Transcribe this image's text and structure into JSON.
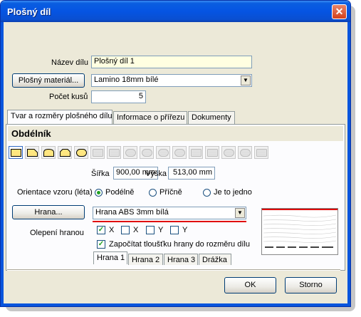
{
  "window": {
    "title": "Plošný díl",
    "close_icon": "close-icon"
  },
  "form": {
    "name_label": "Název dílu",
    "name_value": "Plošný díl 1",
    "material_button": "Plošný materiál...",
    "material_value": "Lamino 18mm bílé",
    "count_label": "Počet kusů",
    "count_value": "5"
  },
  "tabs": [
    {
      "label": "Tvar a rozměry plošného dílu",
      "active": true
    },
    {
      "label": "Informace o přířezu",
      "active": false
    },
    {
      "label": "Dokumenty",
      "active": false
    }
  ],
  "shape": {
    "header": "Obdélník",
    "buttons": [
      "rectangle",
      "chamfer-corner",
      "round-corner",
      "chamfer-both",
      "round-both",
      "hatched-1",
      "hatched-2",
      "oval-1",
      "oval-2",
      "semicircle",
      "circle",
      "hatched-3",
      "hatched-4",
      "oval-3",
      "oval-4",
      "hatched-5"
    ]
  },
  "dimensions": {
    "width_label": "Šířka",
    "width_value": "900,00 mm",
    "height_label": "Výška",
    "height_value": "513,00 mm"
  },
  "orientation": {
    "label": "Orientace vzoru (léta)",
    "options": [
      {
        "label": "Podélně",
        "checked": true
      },
      {
        "label": "Příčně",
        "checked": false
      },
      {
        "label": "Je to jedno",
        "checked": false
      }
    ]
  },
  "edge": {
    "button": "Hrana...",
    "value": "Hrana ABS 3mm bílá",
    "glue_label": "Olepení hranou",
    "checks": [
      {
        "label": "X",
        "checked": true
      },
      {
        "label": "X",
        "checked": false
      },
      {
        "label": "Y",
        "checked": false
      },
      {
        "label": "Y",
        "checked": false
      }
    ],
    "thickness_label": "Započítat tloušťku hrany do rozměru dílu",
    "thickness_checked": true,
    "accent": "#e00000"
  },
  "edge_tabs": [
    {
      "label": "Hrana 1",
      "active": true
    },
    {
      "label": "Hrana 2",
      "active": false
    },
    {
      "label": "Hrana 3",
      "active": false
    },
    {
      "label": "Drážka",
      "active": false
    }
  ],
  "buttons": {
    "ok": "OK",
    "cancel": "Storno"
  }
}
